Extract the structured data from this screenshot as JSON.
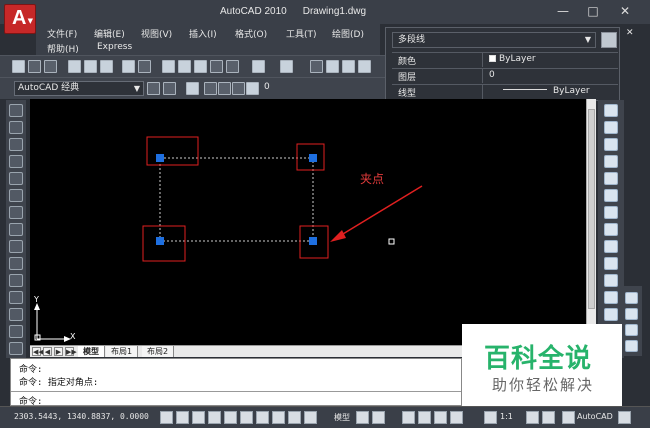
{
  "window": {
    "app_title": "AutoCAD 2010",
    "doc_title": "Drawing1.dwg",
    "logo_text": "A",
    "minimize": "—",
    "maximize": "□",
    "close": "✕"
  },
  "menu": {
    "row1": [
      "文件(F)",
      "编辑(E)",
      "视图(V)",
      "插入(I)",
      "格式(O)",
      "工具(T)",
      "绘图(D)"
    ],
    "row2": [
      "帮助(H)",
      "Express"
    ]
  },
  "workspace": {
    "value": "AutoCAD 经典"
  },
  "layer": {
    "value": "0"
  },
  "properties": {
    "object_type": "多段线",
    "rows": [
      {
        "key": "颜色",
        "value": "ByLayer"
      },
      {
        "key": "图层",
        "value": "0"
      },
      {
        "key": "线型",
        "value": "ByLayer"
      }
    ],
    "close_glyph": "✕"
  },
  "canvas": {
    "annotation": "夹点",
    "ucs_x": "X",
    "ucs_y": "Y",
    "colors": {
      "grip": "#1e6fe0",
      "highlight": "#e02020",
      "dashed": "#cccccc"
    }
  },
  "tabs": {
    "nav": [
      "◀◀",
      "◀",
      "▶",
      "▶▶"
    ],
    "items": [
      "模型",
      "布局1",
      "布局2"
    ],
    "active": "模型"
  },
  "command": {
    "lines": [
      "命令:",
      "命令: 指定对角点:",
      "命令:"
    ]
  },
  "status": {
    "coords": "2303.5443, 1340.8837, 0.0000",
    "model": "模型",
    "scale": "1:1",
    "workspace": "AutoCAD"
  },
  "watermark": {
    "title": "百科全说",
    "subtitle": "助你轻松解决"
  }
}
